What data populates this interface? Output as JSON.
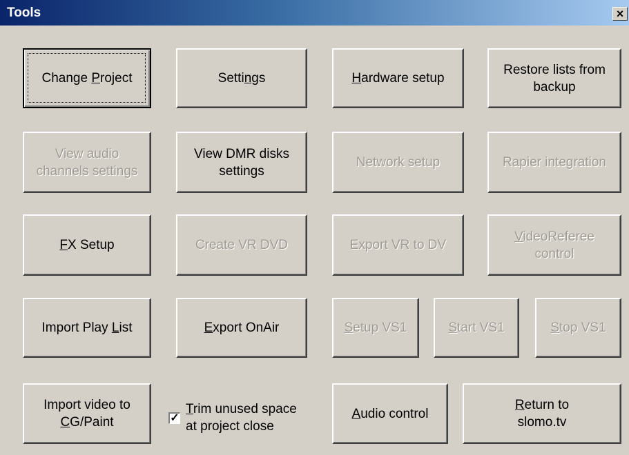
{
  "window": {
    "title": "Tools",
    "close_icon": "close-icon",
    "close_glyph": "×"
  },
  "buttons": {
    "change_project": {
      "pre": "Change ",
      "mn": "P",
      "post": "roject",
      "enabled": true,
      "default": true
    },
    "settings": {
      "pre": "Setti",
      "mn": "n",
      "post": "gs",
      "enabled": true
    },
    "hardware_setup": {
      "pre": "",
      "mn": "H",
      "post": "ardware setup",
      "enabled": true
    },
    "restore_lists": {
      "label": "Restore lists from\nbackup",
      "enabled": true
    },
    "view_audio_channels": {
      "label": "View audio\nchannels settings",
      "enabled": false
    },
    "view_dmr_disks": {
      "label": "View DMR disks\nsettings",
      "enabled": true
    },
    "network_setup": {
      "label": "Network setup",
      "enabled": false
    },
    "rapier_integration": {
      "label": "Rapier integration",
      "enabled": false
    },
    "fx_setup": {
      "pre": "",
      "mn": "F",
      "post": "X Setup",
      "enabled": true
    },
    "create_vr_dvd": {
      "label": "Create VR DVD",
      "enabled": false
    },
    "export_vr_to_dv": {
      "label": "Export VR to DV",
      "enabled": false
    },
    "videoreferee_control": {
      "pre": "",
      "mn": "V",
      "post": "ideoReferee\ncontrol",
      "enabled": false
    },
    "import_play_list": {
      "pre": "Import Play ",
      "mn": "L",
      "post": "ist",
      "enabled": true
    },
    "export_onair": {
      "pre": "",
      "mn": "E",
      "post": "xport OnAir",
      "enabled": true
    },
    "setup_vs1": {
      "pre": "",
      "mn": "S",
      "post": "etup VS1",
      "enabled": false
    },
    "start_vs1": {
      "pre": "",
      "mn": "S",
      "post": "tart VS1",
      "enabled": false
    },
    "stop_vs1": {
      "pre": "",
      "mn": "S",
      "post": "top VS1",
      "enabled": false
    },
    "import_video": {
      "pre": "Import video to\n",
      "mn": "C",
      "post": "G/Paint",
      "enabled": true
    },
    "audio_control": {
      "pre": "",
      "mn": "A",
      "post": "udio control",
      "enabled": true
    },
    "return_to_slomo": {
      "pre": "",
      "mn": "R",
      "post": "eturn to\nslomo.tv",
      "enabled": true
    }
  },
  "trim_checkbox": {
    "pre": "",
    "mn": "T",
    "post": "rim unused space\nat project close",
    "checked": true,
    "check_glyph": "✓"
  },
  "colors": {
    "face": "#d4d0c8",
    "title_gradient_start": "#0a246a",
    "title_gradient_end": "#a6caf0",
    "disabled_text": "#a09c94"
  }
}
